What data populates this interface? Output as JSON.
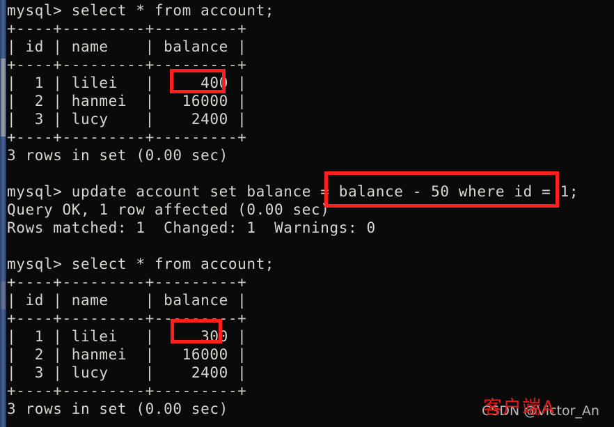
{
  "window": {
    "title": "mysql client terminal",
    "background_color": "#0a0a0a",
    "text_color": "#d8d6cf",
    "scrollbar_color": "#3f5a8f"
  },
  "terminal": {
    "lines": [
      "mysql> select * from account;",
      "+----+---------+---------+",
      "| id | name    | balance |",
      "+----+---------+---------+",
      "|  1 | lilei   |     400 |",
      "|  2 | hanmei  |   16000 |",
      "|  3 | lucy    |    2400 |",
      "+----+---------+---------+",
      "3 rows in set (0.00 sec)",
      "",
      "mysql> update account set balance = balance - 50 where id = 1;",
      "Query OK, 1 row affected (0.00 sec)",
      "Rows matched: 1  Changed: 1  Warnings: 0",
      "",
      "mysql> select * from account;",
      "+----+---------+---------+",
      "| id | name    | balance |",
      "+----+---------+---------+",
      "|  1 | lilei   |     300 |",
      "|  2 | hanmei  |   16000 |",
      "|  3 | lucy    |    2400 |",
      "+----+---------+---------+",
      "3 rows in set (0.00 sec)"
    ],
    "prompt": "mysql>",
    "first_query": "select * from account;",
    "update_statement": "update account set balance = balance - 50 where id = 1;",
    "update_result_ok": "Query OK, 1 row affected (0.00 sec)",
    "update_result_matched": "Rows matched: 1  Changed: 1  Warnings: 0",
    "second_query": "select * from account;",
    "rows_in_set": "3 rows in set (0.00 sec)"
  },
  "table_before": {
    "columns": [
      "id",
      "name",
      "balance"
    ],
    "rows": [
      {
        "id": "1",
        "name": "lilei",
        "balance": "400"
      },
      {
        "id": "2",
        "name": "hanmei",
        "balance": "16000"
      },
      {
        "id": "3",
        "name": "lucy",
        "balance": "2400"
      }
    ],
    "footer": "3 rows in set (0.00 sec)"
  },
  "table_after": {
    "columns": [
      "id",
      "name",
      "balance"
    ],
    "rows": [
      {
        "id": "1",
        "name": "lilei",
        "balance": "300"
      },
      {
        "id": "2",
        "name": "hanmei",
        "balance": "16000"
      },
      {
        "id": "3",
        "name": "lucy",
        "balance": "2400"
      }
    ],
    "footer": "3 rows in set (0.00 sec)"
  },
  "annotations": {
    "color": "#ff1f1f",
    "highlight_before_value": "400",
    "highlight_after_value": "300",
    "highlight_statement": "balance - 50 where id = 1"
  },
  "watermark": {
    "label_cn": "客户端A",
    "label_cn_color": "#e21b1b",
    "credit": "CSDN @Victor_An",
    "credit_color": "#c9c9c9"
  }
}
